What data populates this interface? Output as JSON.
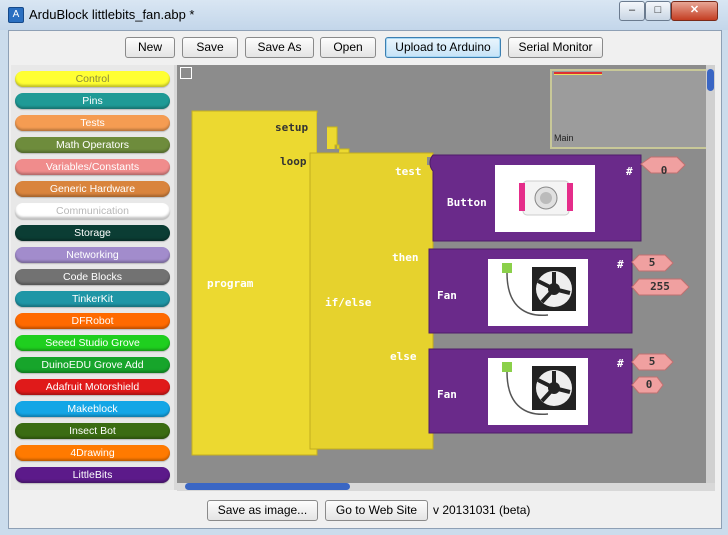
{
  "window": {
    "title": "ArduBlock littlebits_fan.abp *",
    "minimize": "–",
    "maximize": "□",
    "close": "✕"
  },
  "toolbar": {
    "new": "New",
    "save": "Save",
    "save_as": "Save As",
    "open": "Open",
    "upload": "Upload to Arduino",
    "serial": "Serial Monitor"
  },
  "palette": {
    "categories": [
      {
        "label": "Control",
        "color": "#ffff33",
        "text": "#8a8a3a"
      },
      {
        "label": "Pins",
        "color": "#1f9a96",
        "text": "#ffffff"
      },
      {
        "label": "Tests",
        "color": "#f59c52",
        "text": "#ffffff"
      },
      {
        "label": "Math Operators",
        "color": "#6e8c3c",
        "text": "#ffffff"
      },
      {
        "label": "Variables/Constants",
        "color": "#f08c8c",
        "text": "#ffffff"
      },
      {
        "label": "Generic Hardware",
        "color": "#d9843d",
        "text": "#ffffff"
      },
      {
        "label": "Communication",
        "color": "#ffffff",
        "text": "#b8b8b8"
      },
      {
        "label": "Storage",
        "color": "#0b3d34",
        "text": "#ffffff"
      },
      {
        "label": "Networking",
        "color": "#a28ccc",
        "text": "#ffffff"
      },
      {
        "label": "Code Blocks",
        "color": "#727272",
        "text": "#ffffff"
      },
      {
        "label": "TinkerKit",
        "color": "#1f96a6",
        "text": "#ffffff"
      },
      {
        "label": "DFRobot",
        "color": "#ff6a00",
        "text": "#ffffff"
      },
      {
        "label": "Seeed Studio Grove",
        "color": "#1fcf1f",
        "text": "#ffffff"
      },
      {
        "label": "DuinoEDU Grove Add",
        "color": "#17a52b",
        "text": "#ffffff"
      },
      {
        "label": "Adafruit Motorshield",
        "color": "#e01a1a",
        "text": "#ffffff"
      },
      {
        "label": "Makeblock",
        "color": "#14a6e6",
        "text": "#ffffff"
      },
      {
        "label": "Insect Bot",
        "color": "#3b6c12",
        "text": "#ffffff"
      },
      {
        "label": "4Drawing",
        "color": "#ff7a00",
        "text": "#ffffff"
      },
      {
        "label": "LittleBits",
        "color": "#5c1a8a",
        "text": "#ffffff"
      }
    ]
  },
  "minimap": {
    "label": "Main"
  },
  "blocks": {
    "program": {
      "label": "program",
      "setup": "setup",
      "loop": "loop"
    },
    "ifelse": {
      "label": "if/else",
      "test": "test",
      "then": "then",
      "else": "else"
    },
    "button": {
      "label": "Button",
      "hash": "#",
      "pin": "0"
    },
    "fan1": {
      "label": "Fan",
      "hash": "#",
      "pin": "5",
      "value": "255"
    },
    "fan2": {
      "label": "Fan",
      "hash": "#",
      "pin": "5",
      "value": "0"
    }
  },
  "bottom": {
    "save_image": "Save as image...",
    "website": "Go to Web Site",
    "version": "v 20131031 (beta)"
  }
}
